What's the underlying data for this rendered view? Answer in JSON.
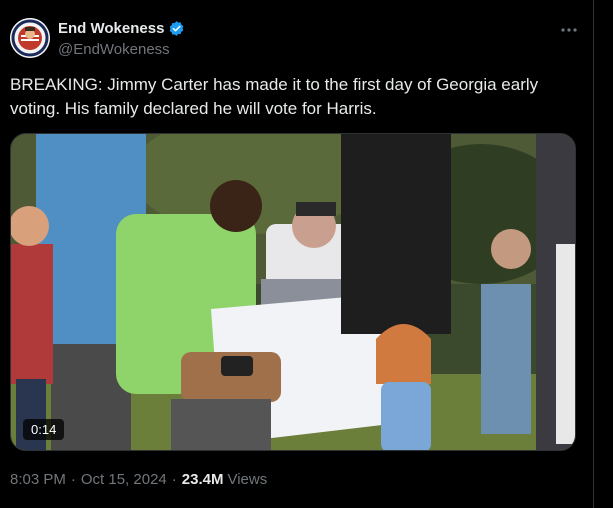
{
  "author": {
    "display_name": "End Wokeness",
    "handle": "@EndWokeness",
    "verified": true
  },
  "icons": {
    "verified": "verified-badge-icon",
    "more": "more-horizontal-icon"
  },
  "tweet": {
    "text": "BREAKING: Jimmy Carter has made it to the first day of Georgia early voting. His family declared he will vote for Harris."
  },
  "media": {
    "type": "video",
    "duration": "0:14"
  },
  "meta": {
    "time": "8:03 PM",
    "date": "Oct 15, 2024",
    "views_count": "23.4M",
    "views_label": "Views",
    "separator": "·"
  },
  "colors": {
    "background": "#000000",
    "text_primary": "#e7e9ea",
    "text_secondary": "#71767b",
    "verified_blue": "#1d9bf0",
    "border": "#2f3336"
  }
}
